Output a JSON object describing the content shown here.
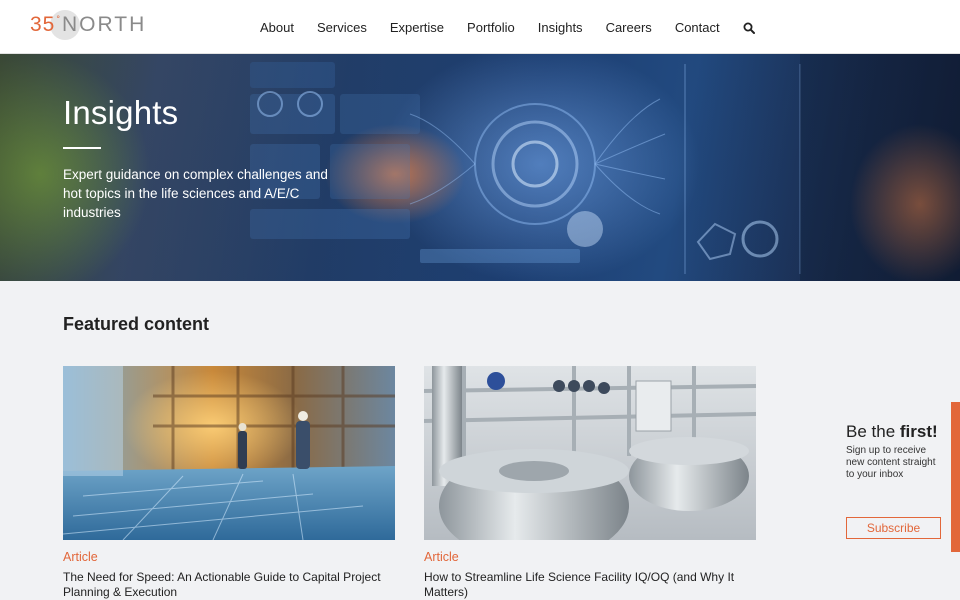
{
  "brand": {
    "num": "35",
    "deg": "°",
    "word": "NORTH",
    "accent": "#e2673a"
  },
  "nav": {
    "items": [
      "About",
      "Services",
      "Expertise",
      "Portfolio",
      "Insights",
      "Careers",
      "Contact"
    ],
    "search_icon": "search-icon"
  },
  "hero": {
    "title": "Insights",
    "subtitle": "Expert guidance on complex challenges and hot topics in the life sciences and A/E/C industries"
  },
  "featured": {
    "heading_light": "Featured",
    "heading_bold": "content",
    "cards": [
      {
        "type": "Article",
        "title": "The Need for Speed: An Actionable Guide to Capital Project Planning & Execution"
      },
      {
        "type": "Article",
        "title": "How to Streamline Life Science Facility IQ/OQ (and Why It Matters)"
      }
    ]
  },
  "subscribe": {
    "title_light": "Be the",
    "title_bold": "first!",
    "text": "Sign up to receive new content straight to your inbox",
    "button": "Subscribe"
  }
}
